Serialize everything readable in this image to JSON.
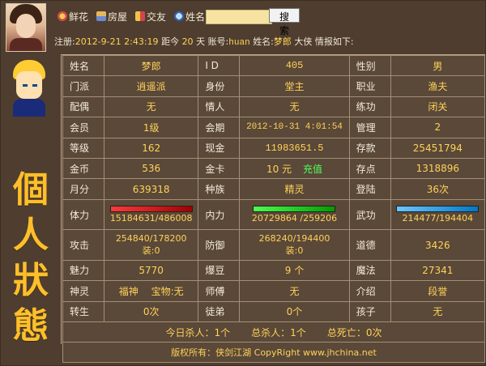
{
  "header": {
    "links": [
      {
        "label": "鲜花",
        "icon": "flower-icon"
      },
      {
        "label": "房屋",
        "icon": "house-icon"
      },
      {
        "label": "交友",
        "icon": "friend-icon"
      },
      {
        "label": "姓名",
        "icon": "search-icon"
      }
    ],
    "search": {
      "placeholder": "",
      "button": "搜 索"
    },
    "reg": {
      "prefix": "注册:",
      "date": "2012-9-21 2:43:19",
      "dist_label": "距今",
      "days": "20",
      "days_unit": "天",
      "account_label": "账号:",
      "account": "huan",
      "name_label": "姓名:",
      "name": "梦郎",
      "title": "大侠",
      "suffix": "情报如下:"
    }
  },
  "left": {
    "title_chars": [
      "個",
      "人",
      "狀",
      "態"
    ]
  },
  "profile": {
    "rows": [
      [
        {
          "k": "姓名",
          "v": "梦郎"
        },
        {
          "k": "I D",
          "v": "405"
        },
        {
          "k": "性别",
          "v": "男"
        }
      ],
      [
        {
          "k": "门派",
          "v": "逍遥派"
        },
        {
          "k": "身份",
          "v": "堂主"
        },
        {
          "k": "职业",
          "v": "渔夫"
        }
      ],
      [
        {
          "k": "配偶",
          "v": "无"
        },
        {
          "k": "情人",
          "v": "无"
        },
        {
          "k": "练功",
          "v": "闭关"
        }
      ],
      [
        {
          "k": "会员",
          "v": "1级"
        },
        {
          "k": "会期",
          "v": "2012-10-31 4:01:54"
        },
        {
          "k": "管理",
          "v": "2"
        }
      ],
      [
        {
          "k": "等级",
          "v": "162"
        },
        {
          "k": "现金",
          "v": "11983651.5"
        },
        {
          "k": "存款",
          "v": "25451794"
        }
      ],
      [
        {
          "k": "金币",
          "v": "536"
        },
        {
          "k": "金卡",
          "v": "10 元",
          "extra": "充值"
        },
        {
          "k": "存点",
          "v": "1318896"
        }
      ],
      [
        {
          "k": "月分",
          "v": "639318"
        },
        {
          "k": "种族",
          "v": "精灵"
        },
        {
          "k": "登陆",
          "v": "36次"
        }
      ]
    ],
    "bars": [
      {
        "k": "体力",
        "v": "15184631/486008",
        "color": "red"
      },
      {
        "k": "内力",
        "v": "20729864 /259206",
        "color": "green"
      },
      {
        "k": "武功",
        "v": "214477/194404",
        "color": "blue"
      }
    ],
    "attack": {
      "k": "攻击",
      "v1": "254840/178200",
      "v2": "装:0"
    },
    "defense": {
      "k": "防御",
      "v1": "268240/194400",
      "v2": "装:0"
    },
    "morality": {
      "k": "道德",
      "v": "3426"
    },
    "rows2": [
      [
        {
          "k": "魅力",
          "v": "5770"
        },
        {
          "k": "爆豆",
          "v": "9 个"
        },
        {
          "k": "魔法",
          "v": "27341"
        }
      ],
      [
        {
          "k": "神灵",
          "v": "福神",
          "extra": "宝物:无"
        },
        {
          "k": "师傅",
          "v": "无"
        },
        {
          "k": "介绍",
          "v": "段誉"
        }
      ],
      [
        {
          "k": "转生",
          "v": "0次"
        },
        {
          "k": "徒弟",
          "v": "0个"
        },
        {
          "k": "孩子",
          "v": "无"
        }
      ]
    ]
  },
  "footer": {
    "today_kills": "今日杀人：1个",
    "total_kills": "总杀人：1个",
    "total_deaths": "总死亡：0次",
    "copyright": "版权所有：侠剑江湖 CopyRight www.jhchina.net"
  }
}
